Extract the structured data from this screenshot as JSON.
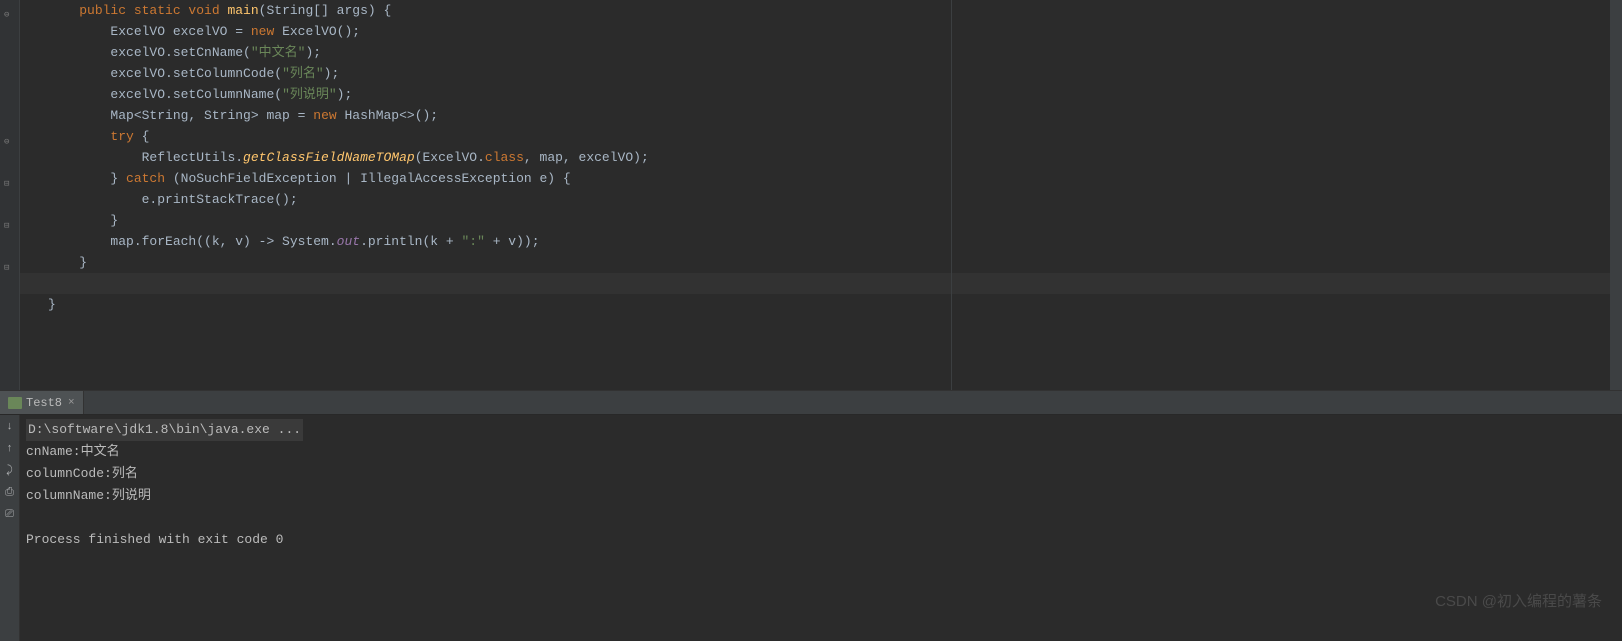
{
  "code": {
    "lines": [
      {
        "indent": 1,
        "tokens": [
          {
            "t": "kw",
            "v": "public static void "
          },
          {
            "t": "method",
            "v": "main"
          },
          {
            "t": "norm",
            "v": "(String[] args) {"
          }
        ]
      },
      {
        "indent": 2,
        "tokens": [
          {
            "t": "norm",
            "v": "ExcelVO excelVO = "
          },
          {
            "t": "kw",
            "v": "new "
          },
          {
            "t": "norm",
            "v": "ExcelVO();"
          }
        ]
      },
      {
        "indent": 2,
        "tokens": [
          {
            "t": "norm",
            "v": "excelVO.setCnName("
          },
          {
            "t": "str",
            "v": "\"中文名\""
          },
          {
            "t": "norm",
            "v": ");"
          }
        ]
      },
      {
        "indent": 2,
        "tokens": [
          {
            "t": "norm",
            "v": "excelVO.setColumnCode("
          },
          {
            "t": "str",
            "v": "\"列名\""
          },
          {
            "t": "norm",
            "v": ");"
          }
        ]
      },
      {
        "indent": 2,
        "tokens": [
          {
            "t": "norm",
            "v": "excelVO.setColumnName("
          },
          {
            "t": "str",
            "v": "\"列说明\""
          },
          {
            "t": "norm",
            "v": ");"
          }
        ]
      },
      {
        "indent": 2,
        "tokens": [
          {
            "t": "norm",
            "v": "Map<String, String> map = "
          },
          {
            "t": "kw",
            "v": "new "
          },
          {
            "t": "norm",
            "v": "HashMap<>();"
          }
        ]
      },
      {
        "indent": 2,
        "tokens": [
          {
            "t": "kw",
            "v": "try "
          },
          {
            "t": "norm",
            "v": "{"
          }
        ]
      },
      {
        "indent": 3,
        "tokens": [
          {
            "t": "norm",
            "v": "ReflectUtils."
          },
          {
            "t": "method-italic",
            "v": "getClassFieldNameTOMap"
          },
          {
            "t": "norm",
            "v": "(ExcelVO."
          },
          {
            "t": "kw",
            "v": "class"
          },
          {
            "t": "norm",
            "v": ", map, excelVO);"
          }
        ]
      },
      {
        "indent": 2,
        "tokens": [
          {
            "t": "norm",
            "v": "} "
          },
          {
            "t": "kw",
            "v": "catch "
          },
          {
            "t": "norm",
            "v": "(NoSuchFieldException | IllegalAccessException e) {"
          }
        ]
      },
      {
        "indent": 3,
        "tokens": [
          {
            "t": "norm",
            "v": "e.printStackTrace();"
          }
        ]
      },
      {
        "indent": 2,
        "tokens": [
          {
            "t": "norm",
            "v": "}"
          }
        ]
      },
      {
        "indent": 2,
        "tokens": [
          {
            "t": "norm",
            "v": "map.forEach((k, v) -> System."
          },
          {
            "t": "field-italic",
            "v": "out"
          },
          {
            "t": "norm",
            "v": ".println(k + "
          },
          {
            "t": "str",
            "v": "\":\""
          },
          {
            "t": "norm",
            "v": " + v));"
          }
        ]
      },
      {
        "indent": 1,
        "tokens": [
          {
            "t": "norm",
            "v": "}"
          }
        ]
      },
      {
        "indent": 0,
        "tokens": []
      },
      {
        "indent": 0,
        "tokens": [
          {
            "t": "norm",
            "v": "}"
          }
        ]
      }
    ]
  },
  "tab": {
    "name": "Test8"
  },
  "console": {
    "cmd": "D:\\software\\jdk1.8\\bin\\java.exe ...",
    "lines": [
      "cnName:中文名",
      "columnCode:列名",
      "columnName:列说明",
      "",
      "Process finished with exit code 0"
    ]
  },
  "watermark": "CSDN @初入编程的薯条"
}
